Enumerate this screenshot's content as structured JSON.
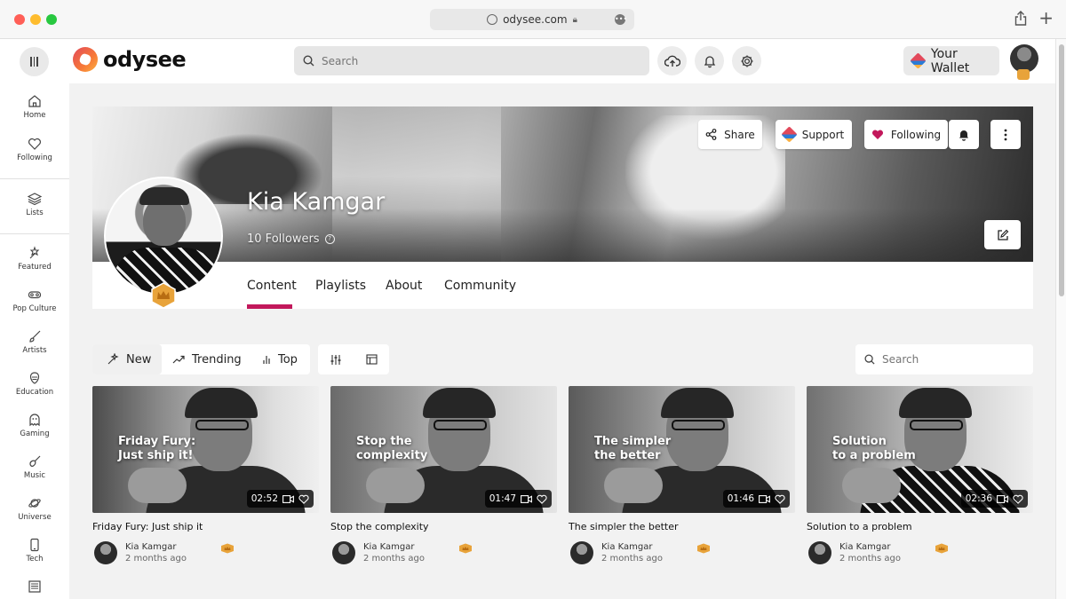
{
  "browser": {
    "url": "odysee.com"
  },
  "header": {
    "logo_text": "odysee",
    "search_placeholder": "Search",
    "wallet_label": "Your Wallet"
  },
  "sidebar": {
    "items": [
      {
        "label": "Home",
        "icon": "home-icon"
      },
      {
        "label": "Following",
        "icon": "heart-icon"
      },
      {
        "label": "Lists",
        "icon": "layers-icon"
      },
      {
        "label": "Featured",
        "icon": "featured-icon"
      },
      {
        "label": "Pop Culture",
        "icon": "pop-culture-icon"
      },
      {
        "label": "Artists",
        "icon": "brush-icon"
      },
      {
        "label": "Education",
        "icon": "education-icon"
      },
      {
        "label": "Gaming",
        "icon": "ghost-icon"
      },
      {
        "label": "Music",
        "icon": "guitar-icon"
      },
      {
        "label": "Universe",
        "icon": "planet-icon"
      },
      {
        "label": "Tech",
        "icon": "phone-icon"
      }
    ]
  },
  "channel": {
    "name": "Kia Kamgar",
    "followers": "10 Followers",
    "buttons": {
      "share": "Share",
      "support": "Support",
      "following": "Following"
    },
    "tabs": [
      "Content",
      "Playlists",
      "About",
      "Community"
    ],
    "active_tab": "Content"
  },
  "filters": {
    "items": [
      "New",
      "Trending",
      "Top"
    ],
    "active": "New",
    "search_placeholder": "Search"
  },
  "videos": [
    {
      "title": "Friday Fury: Just ship it",
      "overlay": "Friday Fury:\nJust ship it!",
      "duration": "02:52",
      "author": "Kia Kamgar",
      "time": "2 months ago"
    },
    {
      "title": "Stop the complexity",
      "overlay": "Stop the\ncomplexity",
      "duration": "01:47",
      "author": "Kia Kamgar",
      "time": "2 months ago"
    },
    {
      "title": "The simpler the better",
      "overlay": "The simpler\nthe better",
      "duration": "01:46",
      "author": "Kia Kamgar",
      "time": "2 months ago"
    },
    {
      "title": "Solution to a problem",
      "overlay": "Solution\nto a problem",
      "duration": "02:36",
      "author": "Kia Kamgar",
      "time": "2 months ago"
    }
  ],
  "colors": {
    "accent": "#c2185b",
    "badge": "#e8a33a"
  }
}
